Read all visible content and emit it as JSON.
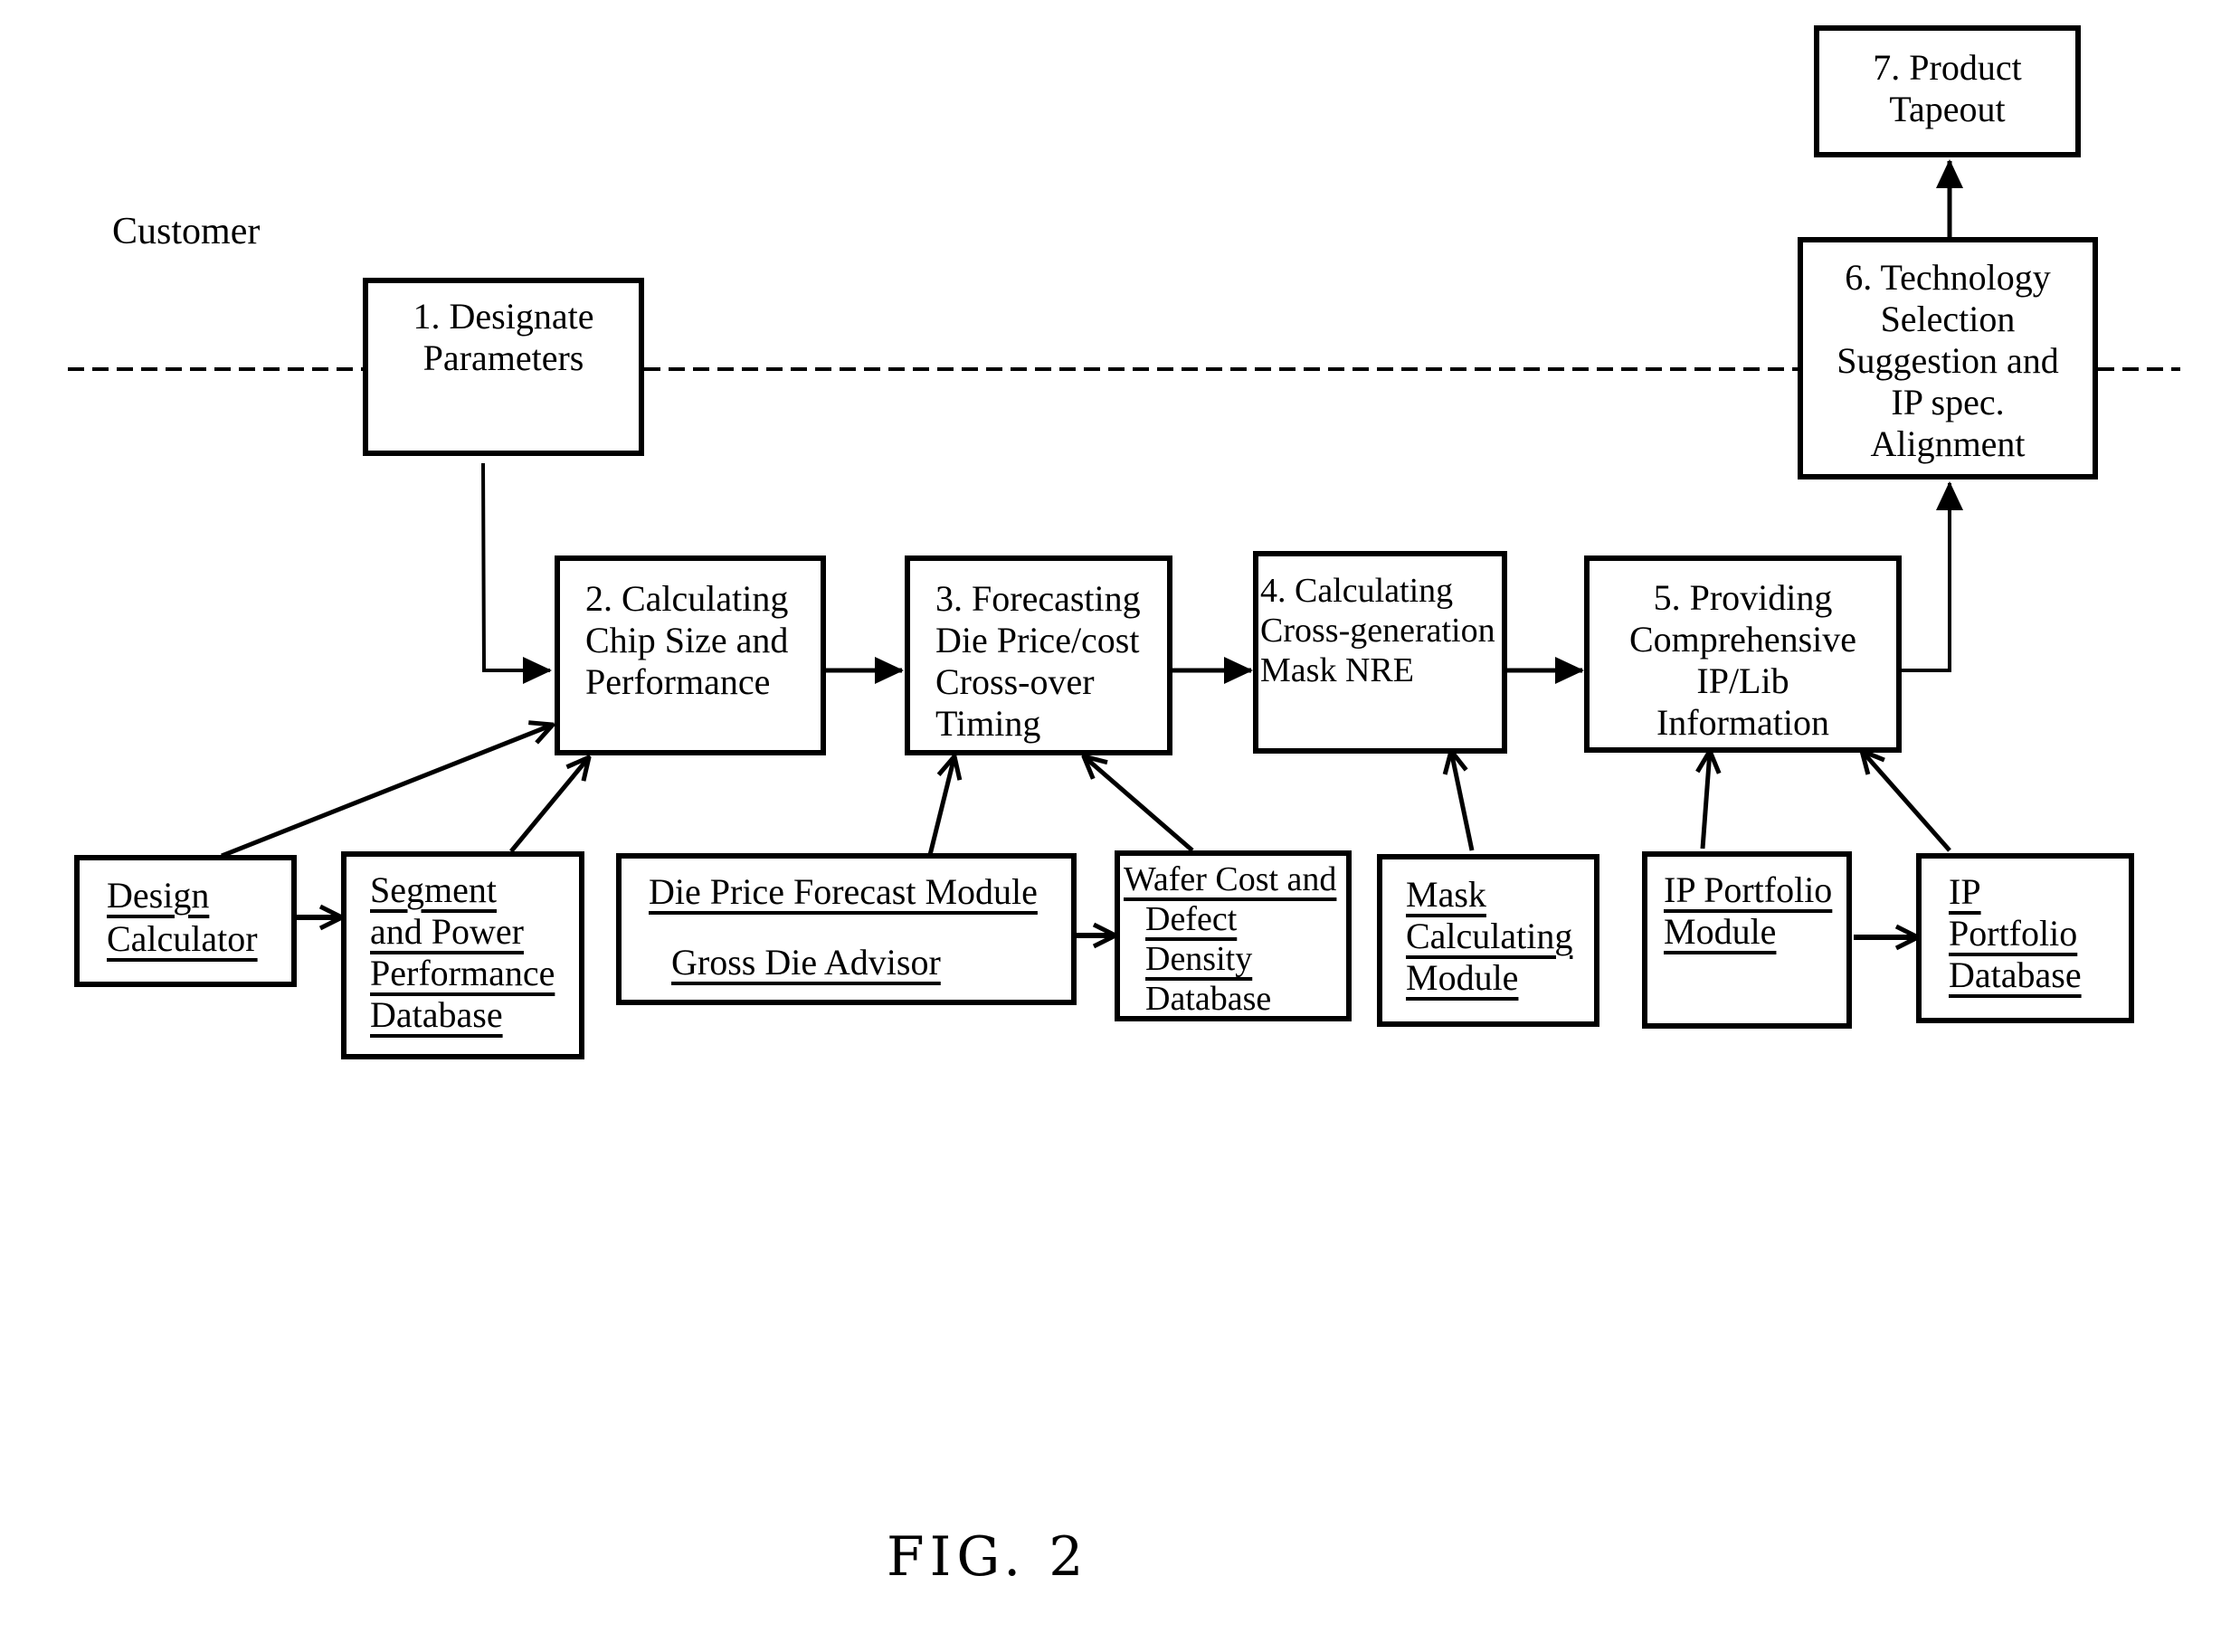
{
  "zone_label": "Customer",
  "figure_caption": "FIG. 2",
  "steps": [
    {
      "id": "step1",
      "lines": [
        "1. Designate",
        "Parameters"
      ]
    },
    {
      "id": "step2",
      "lines": [
        "2. Calculating",
        "Chip Size and",
        "Performance"
      ]
    },
    {
      "id": "step3",
      "lines": [
        "3. Forecasting",
        "Die Price/cost",
        "Cross-over",
        "Timing"
      ]
    },
    {
      "id": "step4",
      "lines": [
        "4. Calculating",
        "Cross-generation",
        "Mask NRE"
      ]
    },
    {
      "id": "step5",
      "lines": [
        "5. Providing",
        "Comprehensive",
        "IP/Lib",
        "Information"
      ]
    },
    {
      "id": "step6",
      "lines": [
        "6. Technology",
        "Selection",
        "Suggestion and",
        "IP spec.",
        "Alignment"
      ]
    },
    {
      "id": "step7",
      "lines": [
        "7. Product",
        "Tapeout"
      ]
    }
  ],
  "modules": [
    {
      "id": "design_calculator",
      "lines": [
        "Design",
        "Calculator"
      ]
    },
    {
      "id": "segment_db",
      "lines": [
        "Segment",
        "and Power",
        "Performance",
        "Database"
      ]
    },
    {
      "id": "die_price_module",
      "lines": [
        "Die Price Forecast  Module",
        "Gross Die Advisor"
      ]
    },
    {
      "id": "wafer_cost_db",
      "lines": [
        "Wafer Cost and",
        "Defect",
        "Density",
        "Database"
      ]
    },
    {
      "id": "mask_module",
      "lines": [
        "Mask",
        "Calculating",
        "Module"
      ]
    },
    {
      "id": "ip_portfolio_module",
      "lines": [
        "IP Portfolio",
        "Module"
      ]
    },
    {
      "id": "ip_portfolio_db",
      "lines": [
        "IP",
        "Portfolio",
        "Database"
      ]
    }
  ]
}
